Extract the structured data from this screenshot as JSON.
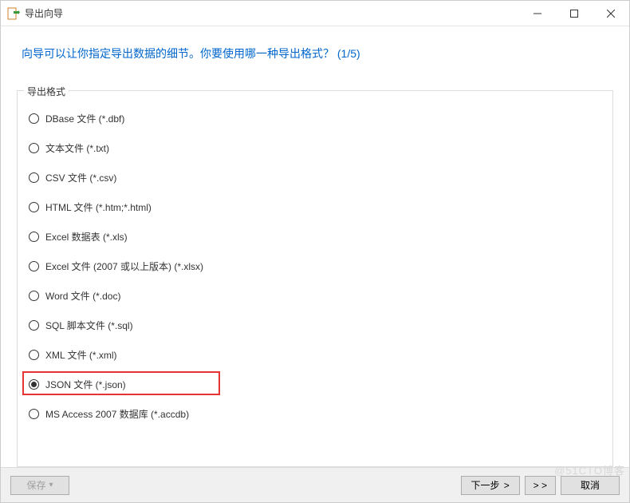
{
  "window": {
    "title": "导出向导"
  },
  "header": {
    "text": "向导可以让你指定导出数据的细节。你要使用哪一种导出格式？ (1/5)"
  },
  "group": {
    "legend": "导出格式",
    "options": [
      {
        "label": "DBase 文件 (*.dbf)",
        "selected": false
      },
      {
        "label": "文本文件 (*.txt)",
        "selected": false
      },
      {
        "label": "CSV 文件 (*.csv)",
        "selected": false
      },
      {
        "label": "HTML 文件 (*.htm;*.html)",
        "selected": false
      },
      {
        "label": "Excel 数据表 (*.xls)",
        "selected": false
      },
      {
        "label": "Excel 文件 (2007 或以上版本) (*.xlsx)",
        "selected": false
      },
      {
        "label": "Word 文件 (*.doc)",
        "selected": false
      },
      {
        "label": "SQL 脚本文件 (*.sql)",
        "selected": false
      },
      {
        "label": "XML 文件 (*.xml)",
        "selected": false
      },
      {
        "label": "JSON 文件 (*.json)",
        "selected": true,
        "highlighted": true
      },
      {
        "label": "MS Access 2007 数据库 (*.accdb)",
        "selected": false
      }
    ]
  },
  "footer": {
    "save": "保存",
    "next": "下一步",
    "skip": "> >",
    "cancel": "取消"
  },
  "watermark": "@51CTO博客"
}
